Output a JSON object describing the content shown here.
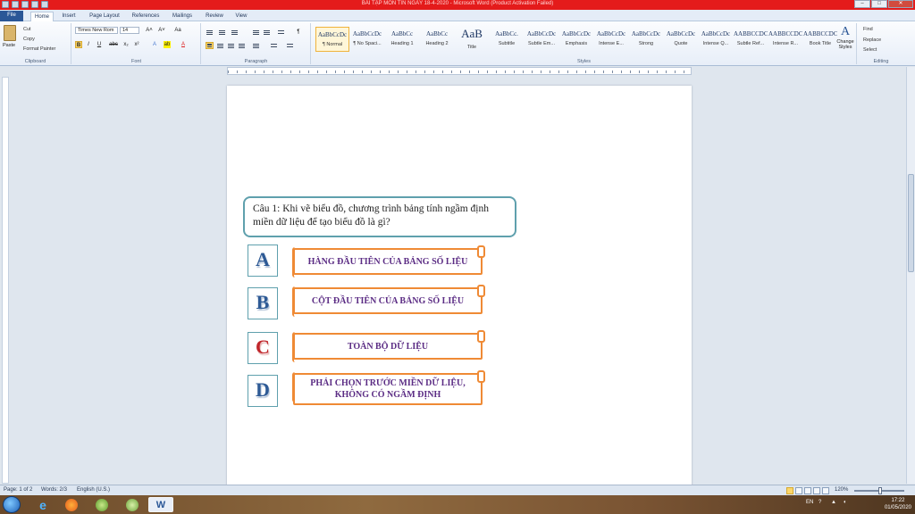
{
  "window": {
    "title": "BÀI TẬP MÔN TIN NGÀY 18-4-2020 - Microsoft Word (Product Activation Failed)",
    "minimize": "–",
    "maximize": "□",
    "close": "✕"
  },
  "tabs": [
    "File",
    "Home",
    "Insert",
    "Page Layout",
    "References",
    "Mailings",
    "Review",
    "View"
  ],
  "ribbon": {
    "clipboard": {
      "paste": "Paste",
      "cut": "Cut",
      "copy": "Copy",
      "format_painter": "Format Painter",
      "label": "Clipboard"
    },
    "font": {
      "name": "Times New Rom",
      "size": "14",
      "label": "Font",
      "bold": "B",
      "italic": "I",
      "underline": "U",
      "strike": "abc",
      "subscript": "x₂",
      "superscript": "x²",
      "grow": "A˄",
      "shrink": "A˅",
      "clear": "Aa",
      "color": "A"
    },
    "paragraph": {
      "label": "Paragraph",
      "pilcrow": "¶"
    },
    "styles": {
      "label": "Styles",
      "items": [
        {
          "sample": "AaBbCcDc",
          "name": "¶ Normal"
        },
        {
          "sample": "AaBbCcDc",
          "name": "¶ No Spaci..."
        },
        {
          "sample": "AaBbCc",
          "name": "Heading 1"
        },
        {
          "sample": "AaBbCc",
          "name": "Heading 2"
        },
        {
          "sample": "AaB",
          "name": "Title"
        },
        {
          "sample": "AaBbCc.",
          "name": "Subtitle"
        },
        {
          "sample": "AaBbCcDc",
          "name": "Subtle Em..."
        },
        {
          "sample": "AaBbCcDc",
          "name": "Emphasis"
        },
        {
          "sample": "AaBbCcDc",
          "name": "Intense E..."
        },
        {
          "sample": "AaBbCcDc",
          "name": "Strong"
        },
        {
          "sample": "AaBbCcDc",
          "name": "Quote"
        },
        {
          "sample": "AaBbCcDc",
          "name": "Intense Q..."
        },
        {
          "sample": "AABBCCDC",
          "name": "Subtle Ref..."
        },
        {
          "sample": "AABBCCDC",
          "name": "Intense R..."
        },
        {
          "sample": "AABBCCDC",
          "name": "Book Title"
        }
      ],
      "change_styles": "Change Styles"
    },
    "editing": {
      "find": "Find",
      "replace": "Replace",
      "select": "Select",
      "label": "Editing"
    }
  },
  "document": {
    "question": "Câu 1: Khi vẽ biểu đồ, chương trình bảng tính ngầm định miền dữ liệu để tạo biểu đồ là gì?",
    "options": [
      {
        "letter": "A",
        "text": "HÀNG ĐẦU TIÊN CỦA BẢNG SỐ LIỆU"
      },
      {
        "letter": "B",
        "text": "CỘT ĐẦU TIÊN CỦA BẢNG SỐ LIỆU"
      },
      {
        "letter": "C",
        "text": "TOÀN BỘ DỮ LIỆU"
      },
      {
        "letter": "D",
        "text_line1": "PHẢI CHỌN TRƯỚC MIỀN DỮ LIỆU,",
        "text_line2": "KHÔNG CÓ NGẦM ĐỊNH"
      }
    ]
  },
  "status": {
    "page": "Page: 1 of 2",
    "words": "Words: 2/3",
    "language": "English (U.S.)",
    "zoom": "120%"
  },
  "taskbar": {
    "word_icon": "W",
    "language": "EN",
    "time": "17:22",
    "date": "01/05/2020"
  },
  "colors": {
    "title_bar": "#e41b1b",
    "question_border": "#5fa0ad",
    "option_border": "#ef8a35",
    "option_text": "#5b2c84",
    "letter_blue": "#2e5a95",
    "letter_red": "#c0262b"
  }
}
